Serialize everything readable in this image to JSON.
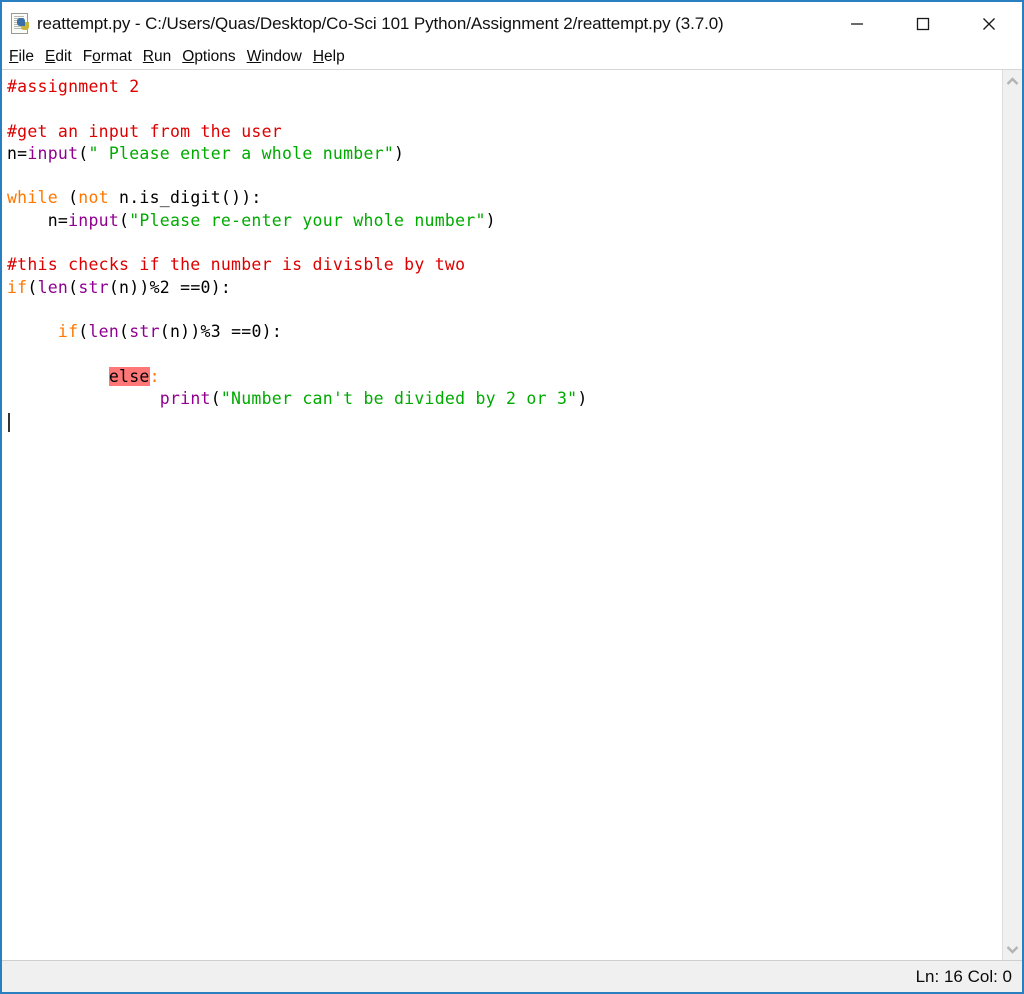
{
  "window": {
    "title": "reattempt.py - C:/Users/Quas/Desktop/Co-Sci 101 Python/Assignment 2/reattempt.py (3.7.0)",
    "icon": "python-file-icon",
    "border_color": "#2a7fc0",
    "controls": {
      "minimize": "minimize-button",
      "maximize": "maximize-button",
      "close": "close-button"
    }
  },
  "menubar": {
    "items": [
      {
        "label": "File",
        "mnemonic": "F",
        "rest": "ile"
      },
      {
        "label": "Edit",
        "mnemonic": "E",
        "rest": "dit"
      },
      {
        "label": "Format",
        "pre": "F",
        "mnemonic": "o",
        "rest": "rmat"
      },
      {
        "label": "Run",
        "mnemonic": "R",
        "rest": "un"
      },
      {
        "label": "Options",
        "mnemonic": "O",
        "rest": "ptions"
      },
      {
        "label": "Window",
        "mnemonic": "W",
        "rest": "indow"
      },
      {
        "label": "Help",
        "mnemonic": "H",
        "rest": "elp"
      }
    ]
  },
  "editor": {
    "syntax_colors": {
      "comment": "#dd0000",
      "keyword": "#ff7700",
      "builtin": "#900090",
      "string": "#00aa00",
      "plain": "#000000",
      "error_highlight_bg": "#ff7777"
    },
    "caret": {
      "line": 16,
      "col": 0
    },
    "lines": [
      {
        "n": 1,
        "tokens": [
          {
            "t": "comment",
            "s": "#assignment 2"
          }
        ]
      },
      {
        "n": 2,
        "tokens": []
      },
      {
        "n": 3,
        "tokens": [
          {
            "t": "comment",
            "s": "#get an input from the user"
          }
        ]
      },
      {
        "n": 4,
        "tokens": [
          {
            "t": "plain",
            "s": "n="
          },
          {
            "t": "builtin",
            "s": "input"
          },
          {
            "t": "plain",
            "s": "("
          },
          {
            "t": "string",
            "s": "\" Please enter a whole number\""
          },
          {
            "t": "plain",
            "s": ")"
          }
        ]
      },
      {
        "n": 5,
        "tokens": []
      },
      {
        "n": 6,
        "tokens": [
          {
            "t": "keyword",
            "s": "while"
          },
          {
            "t": "plain",
            "s": " ("
          },
          {
            "t": "keyword",
            "s": "not"
          },
          {
            "t": "plain",
            "s": " n.is_digit()):"
          }
        ]
      },
      {
        "n": 7,
        "tokens": [
          {
            "t": "plain",
            "s": "    n="
          },
          {
            "t": "builtin",
            "s": "input"
          },
          {
            "t": "plain",
            "s": "("
          },
          {
            "t": "string",
            "s": "\"Please re-enter your whole number\""
          },
          {
            "t": "plain",
            "s": ")"
          }
        ]
      },
      {
        "n": 8,
        "tokens": []
      },
      {
        "n": 9,
        "tokens": [
          {
            "t": "comment",
            "s": "#this checks if the number is divisble by two"
          }
        ]
      },
      {
        "n": 10,
        "tokens": [
          {
            "t": "keyword",
            "s": "if"
          },
          {
            "t": "plain",
            "s": "("
          },
          {
            "t": "builtin",
            "s": "len"
          },
          {
            "t": "plain",
            "s": "("
          },
          {
            "t": "builtin",
            "s": "str"
          },
          {
            "t": "plain",
            "s": "(n))%2 ==0):"
          }
        ]
      },
      {
        "n": 11,
        "tokens": []
      },
      {
        "n": 12,
        "tokens": [
          {
            "t": "plain",
            "s": "     "
          },
          {
            "t": "keyword",
            "s": "if"
          },
          {
            "t": "plain",
            "s": "("
          },
          {
            "t": "builtin",
            "s": "len"
          },
          {
            "t": "plain",
            "s": "("
          },
          {
            "t": "builtin",
            "s": "str"
          },
          {
            "t": "plain",
            "s": "(n))%3 ==0):"
          }
        ]
      },
      {
        "n": 13,
        "tokens": []
      },
      {
        "n": 14,
        "tokens": [
          {
            "t": "plain",
            "s": "          "
          },
          {
            "t": "err",
            "s": "else"
          },
          {
            "t": "keyword",
            "s": ":"
          }
        ]
      },
      {
        "n": 15,
        "tokens": [
          {
            "t": "plain",
            "s": "               "
          },
          {
            "t": "builtin",
            "s": "print"
          },
          {
            "t": "plain",
            "s": "("
          },
          {
            "t": "string",
            "s": "\"Number can't be divided by 2 or 3\""
          },
          {
            "t": "plain",
            "s": ")"
          }
        ]
      },
      {
        "n": 16,
        "tokens": []
      }
    ]
  },
  "scrollbar": {
    "up_arrow": "chevron-up-icon",
    "down_arrow": "chevron-down-icon"
  },
  "statusbar": {
    "position": "Ln: 16 Col: 0"
  }
}
